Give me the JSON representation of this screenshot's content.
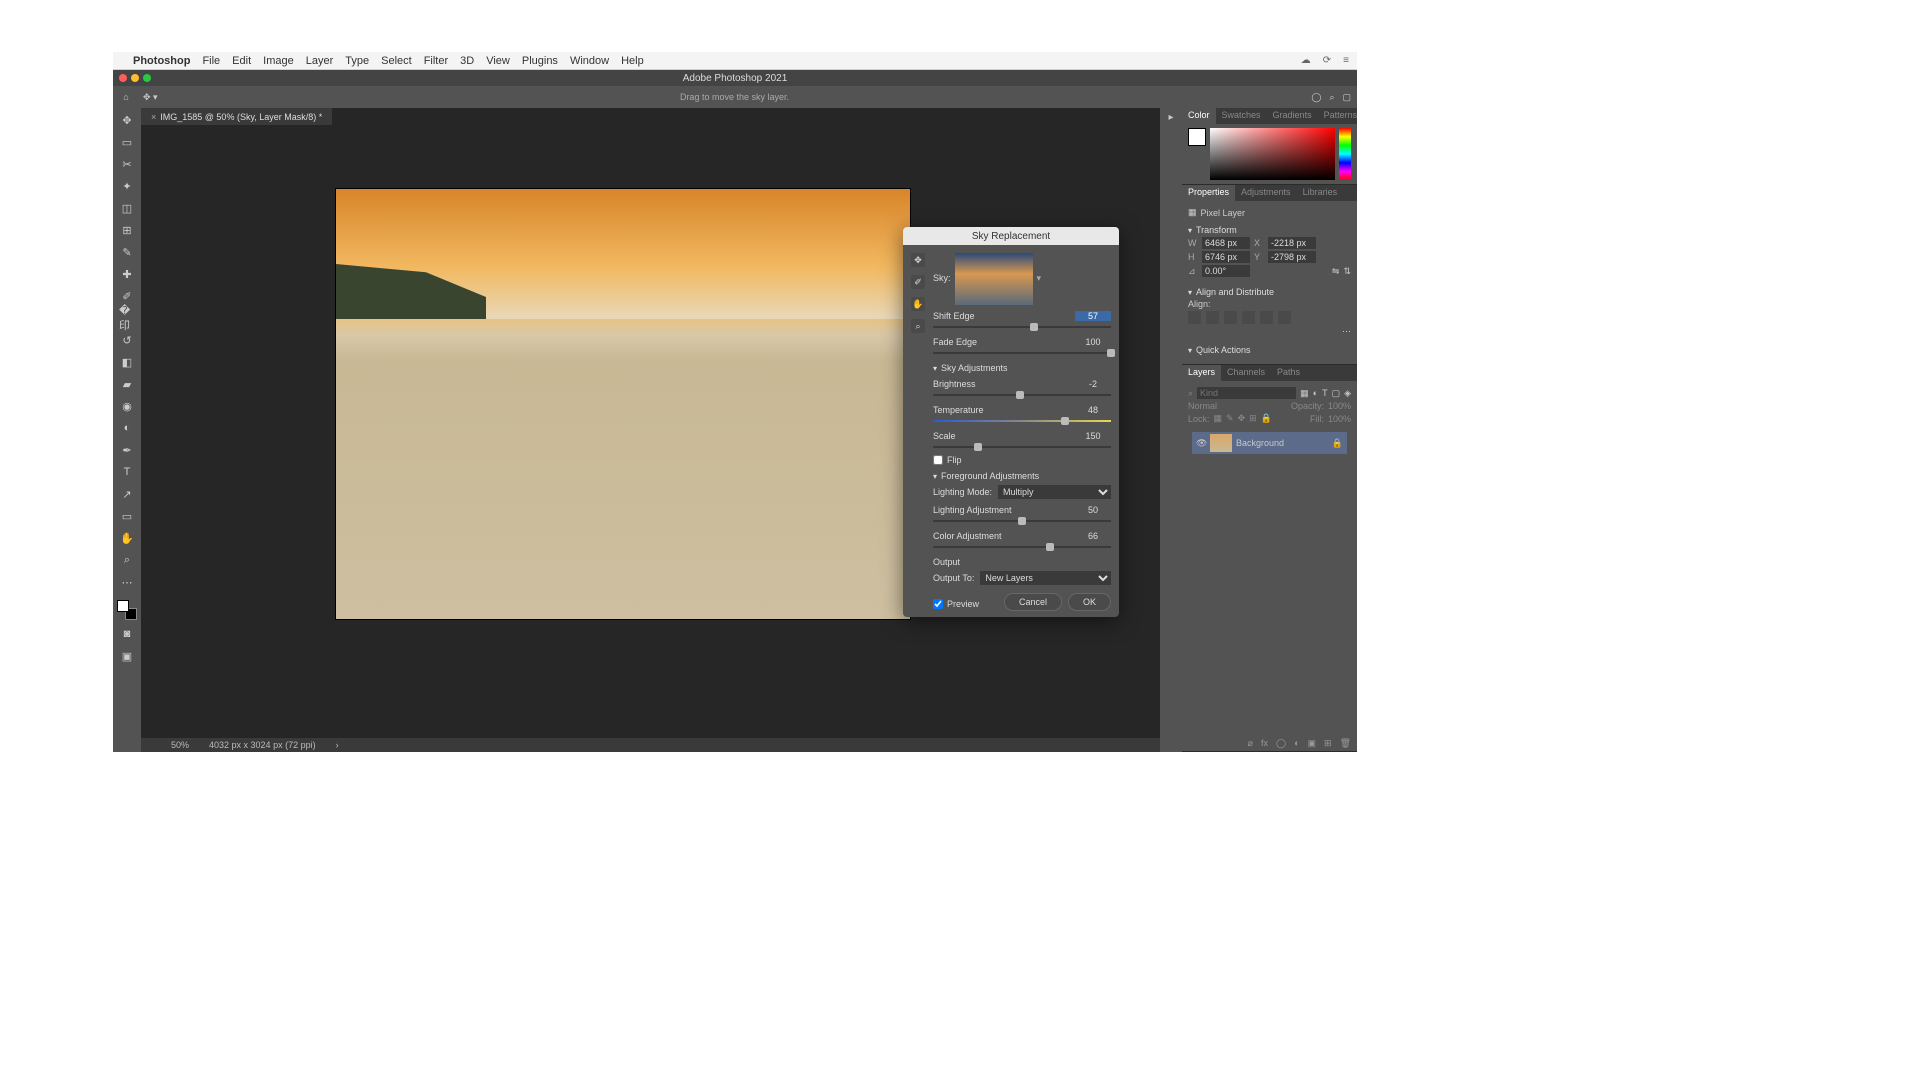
{
  "menubar": {
    "items": [
      "Photoshop",
      "File",
      "Edit",
      "Image",
      "Layer",
      "Type",
      "Select",
      "Filter",
      "3D",
      "View",
      "Plugins",
      "Window",
      "Help"
    ]
  },
  "titlebar": {
    "title": "Adobe Photoshop 2021"
  },
  "optionsbar": {
    "hint": "Drag to move the sky layer."
  },
  "doc": {
    "tab": "IMG_1585 @ 50% (Sky, Layer Mask/8) *",
    "zoom": "50%",
    "dims": "4032 px x 3024 px (72 ppi)"
  },
  "right": {
    "color_tabs": [
      "Color",
      "Swatches",
      "Gradients",
      "Patterns"
    ],
    "props_tabs": [
      "Properties",
      "Adjustments",
      "Libraries"
    ],
    "layer_kind_label": "Pixel Layer",
    "transform": {
      "title": "Transform",
      "W": "6468 px",
      "X": "-2218 px",
      "H": "6746 px",
      "Y": "-2798 px",
      "angle": "0.00°"
    },
    "align_title": "Align and Distribute",
    "align_label": "Align:",
    "quick_title": "Quick Actions",
    "layers_tabs": [
      "Layers",
      "Channels",
      "Paths"
    ],
    "layers_search_placeholder": "Kind",
    "blend_mode": "Normal",
    "opacity_label": "Opacity:",
    "opacity_value": "100%",
    "lock_label": "Lock:",
    "fill_label": "Fill:",
    "fill_value": "100%",
    "layers": [
      {
        "name": "Background"
      }
    ]
  },
  "dialog": {
    "title": "Sky Replacement",
    "sky_label": "Sky:",
    "shift_edge": {
      "label": "Shift Edge",
      "value": "57",
      "pos": 57
    },
    "fade_edge": {
      "label": "Fade Edge",
      "value": "100",
      "pos": 100
    },
    "sky_adj_title": "Sky Adjustments",
    "brightness": {
      "label": "Brightness",
      "value": "-2",
      "pos": 49
    },
    "temperature": {
      "label": "Temperature",
      "value": "48",
      "pos": 74
    },
    "scale": {
      "label": "Scale",
      "value": "150",
      "pos": 25
    },
    "flip_label": "Flip",
    "fg_title": "Foreground Adjustments",
    "lighting_mode_label": "Lighting Mode:",
    "lighting_mode_value": "Multiply",
    "lighting_adj": {
      "label": "Lighting Adjustment",
      "value": "50",
      "pos": 50
    },
    "color_adj": {
      "label": "Color Adjustment",
      "value": "66",
      "pos": 66
    },
    "output_title": "Output",
    "output_to_label": "Output To:",
    "output_to_value": "New Layers",
    "preview_label": "Preview",
    "cancel": "Cancel",
    "ok": "OK"
  }
}
